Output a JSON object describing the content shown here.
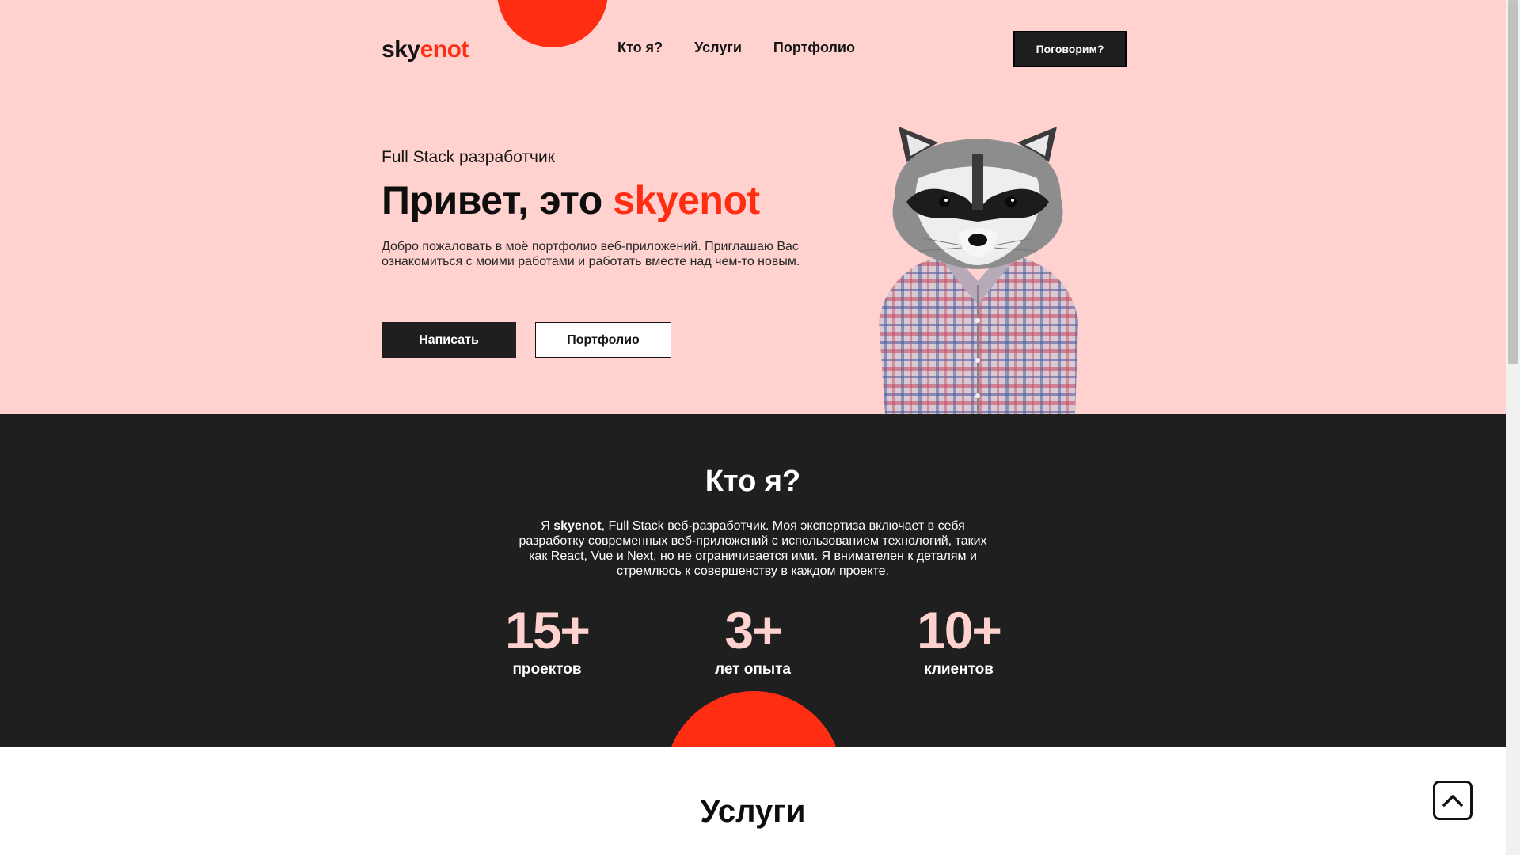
{
  "header": {
    "logo_part1": "sky",
    "logo_part2": "enot",
    "nav": [
      "Кто я?",
      "Услуги",
      "Портфолио"
    ],
    "cta_label": "Поговорим?"
  },
  "hero": {
    "subtitle": "Full Stack разработчик",
    "title_prefix": "Привет, это ",
    "title_accent": "skyenot",
    "description": "Добро пожаловать в моё портфолио веб-приложений. Приглашаю Вас ознакомиться с моими работами и работать вместе над чем-то новым.",
    "write_button": "Написать",
    "portfolio_button": "Портфолио"
  },
  "about": {
    "title": "Кто я?",
    "text_prefix": "Я ",
    "text_name": "skyenot",
    "text_rest": ", Full Stack веб-разработчик. Моя экспертиза включает в себя разработку современных веб-приложений с использованием технологий, таких как React, Vue и Next, но не ограничивается ими. Я внимателен к деталям и стремлюсь к совершенству в каждом проекте.",
    "stats": [
      {
        "value": "15+",
        "label": "проектов"
      },
      {
        "value": "3+",
        "label": "лет опыта"
      },
      {
        "value": "10+",
        "label": "клиентов"
      }
    ]
  },
  "services": {
    "title": "Услуги"
  },
  "icons": {
    "scroll_top": "chevron-up-icon",
    "illustration": "raccoon-in-plaid-shirt"
  },
  "colors": {
    "hero_bg": "#ffd2cf",
    "accent": "#ff2e12",
    "dark": "#1f1f1f"
  }
}
